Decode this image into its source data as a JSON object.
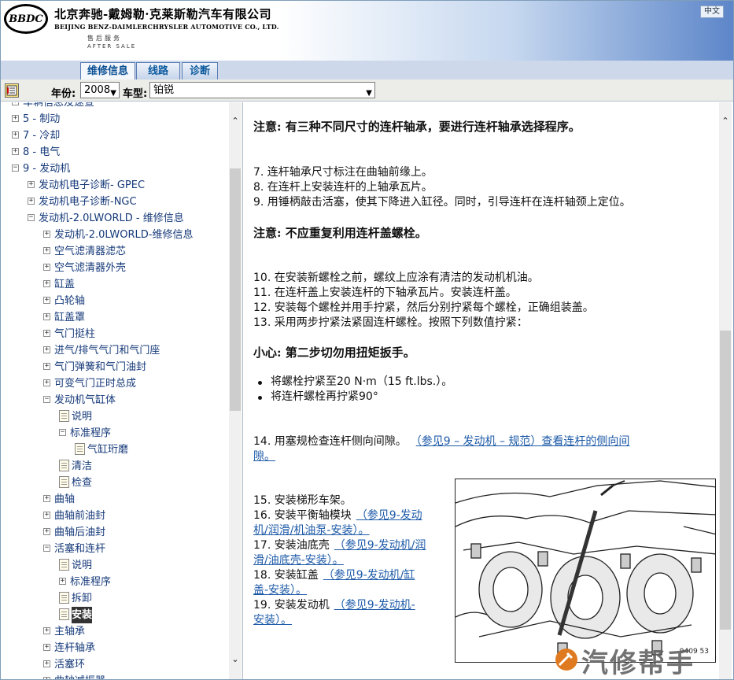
{
  "header": {
    "logo_text": "BBDC",
    "company_cn": "北京奔驰-戴姆勒·克莱斯勒汽车有限公司",
    "company_en": "BEIJING BENZ-DAIMLERCHRYSLER AUTOMOTIVE CO., LTD.",
    "after_sale_cn": "售后服务",
    "after_sale_en": "AFTER SALE",
    "lang_button": "中文"
  },
  "tabs": [
    {
      "label": "维修信息",
      "active": true
    },
    {
      "label": "线路",
      "active": false
    },
    {
      "label": "诊断",
      "active": false
    }
  ],
  "toolbar": {
    "icon": "tree-toggle-icon",
    "year_label": "年份:",
    "year_value": "2008",
    "model_label": "车型:",
    "model_value": "铂锐"
  },
  "tree": [
    {
      "label": "车辆信息及速查",
      "level": 0,
      "box": "+",
      "partial": true
    },
    {
      "label": "5 - 制动",
      "level": 0,
      "box": "+"
    },
    {
      "label": "7 - 冷却",
      "level": 0,
      "box": "+"
    },
    {
      "label": "8 - 电气",
      "level": 0,
      "box": "+"
    },
    {
      "label": "9 - 发动机",
      "level": 0,
      "box": "-"
    },
    {
      "label": "发动机电子诊断- GPEC",
      "level": 1,
      "box": "+"
    },
    {
      "label": "发动机电子诊断-NGC",
      "level": 1,
      "box": "+"
    },
    {
      "label": "发动机-2.0LWORLD - 维修信息",
      "level": 1,
      "box": "-"
    },
    {
      "label": "发动机-2.0LWORLD-维修信息",
      "level": 2,
      "box": "+"
    },
    {
      "label": "空气滤清器滤芯",
      "level": 2,
      "box": "+"
    },
    {
      "label": "空气滤清器外壳",
      "level": 2,
      "box": "+"
    },
    {
      "label": "缸盖",
      "level": 2,
      "box": "+"
    },
    {
      "label": "凸轮轴",
      "level": 2,
      "box": "+"
    },
    {
      "label": "缸盖罩",
      "level": 2,
      "box": "+"
    },
    {
      "label": "气门挺柱",
      "level": 2,
      "box": "+"
    },
    {
      "label": "进气/排气气门和气门座",
      "level": 2,
      "box": "+"
    },
    {
      "label": "气门弹簧和气门油封",
      "level": 2,
      "box": "+"
    },
    {
      "label": "可变气门正时总成",
      "level": 2,
      "box": "+"
    },
    {
      "label": "发动机气缸体",
      "level": 2,
      "box": "-"
    },
    {
      "label": "说明",
      "level": 3,
      "box": "doc"
    },
    {
      "label": "标准程序",
      "level": 3,
      "box": "-"
    },
    {
      "label": "气缸珩磨",
      "level": 4,
      "box": "doc"
    },
    {
      "label": "清洁",
      "level": 3,
      "box": "doc"
    },
    {
      "label": "检查",
      "level": 3,
      "box": "doc"
    },
    {
      "label": "曲轴",
      "level": 2,
      "box": "+"
    },
    {
      "label": "曲轴前油封",
      "level": 2,
      "box": "+"
    },
    {
      "label": "曲轴后油封",
      "level": 2,
      "box": "+"
    },
    {
      "label": "活塞和连杆",
      "level": 2,
      "box": "-"
    },
    {
      "label": "说明",
      "level": 3,
      "box": "doc"
    },
    {
      "label": "标准程序",
      "level": 3,
      "box": "+"
    },
    {
      "label": "拆卸",
      "level": 3,
      "box": "doc"
    },
    {
      "label": "安装",
      "level": 3,
      "box": "doc",
      "selected": true
    },
    {
      "label": "主轴承",
      "level": 2,
      "box": "+"
    },
    {
      "label": "连杆轴承",
      "level": 2,
      "box": "+"
    },
    {
      "label": "活塞环",
      "level": 2,
      "box": "+"
    },
    {
      "label": "曲轴减振器",
      "level": 2,
      "box": "+",
      "partial": true
    }
  ],
  "content": {
    "note1": "注意: 有三种不同尺寸的连杆轴承，要进行连杆轴承选择程序。",
    "steps_a": [
      "7. 连杆轴承尺寸标注在曲轴前缘上。",
      "8. 在连杆上安装连杆的上轴承瓦片。",
      "9. 用锤柄敲击活塞，使其下降进入缸径。同时，引导连杆在连杆轴颈上定位。"
    ],
    "note2": "注意: 不应重复利用连杆盖螺栓。",
    "steps_b": [
      "10. 在安装新螺栓之前，螺纹上应涂有清洁的发动机机油。",
      "11. 在连杆盖上安装连杆的下轴承瓦片。安装连杆盖。",
      "12. 安装每个螺栓并用手拧紧，然后分别拧紧每个螺栓，正确组装盖。",
      "13. 采用两步拧紧法紧固连杆螺栓。按照下列数值拧紧："
    ],
    "caution": "小心: 第二步切勿用扭矩扳手。",
    "bullets": [
      "将螺栓拧紧至20 N·m（15 ft.lbs.）。",
      "将连杆螺栓再拧紧90°"
    ],
    "step14_text": "14. 用塞规检查连杆侧向间隙。",
    "step14_link_1": "（参见9 – 发动机  –  规范）查看连杆的侧向间",
    "step14_link_2": "隙。",
    "steps_c": [
      {
        "text": "15. 安装梯形车架。",
        "link": ""
      },
      {
        "text": "16. 安装平衡轴模块",
        "link": "（参见9-发动",
        "link2": "机/润滑/机油泵-安装）。"
      },
      {
        "text": "17. 安装油底壳",
        "link": "（参见9-发动机/润",
        "link2": "滑/油底壳-安装）。"
      },
      {
        "text": "18. 安装缸盖",
        "link": "（参见9-发动机/缸",
        "link2": "盖-安装）。"
      },
      {
        "text": "19. 安装发动机",
        "link": "（参见9-发动机-",
        "link2": "安装）。"
      }
    ],
    "figure_code": "9409 53"
  },
  "watermark": {
    "text": "汽修帮手"
  }
}
